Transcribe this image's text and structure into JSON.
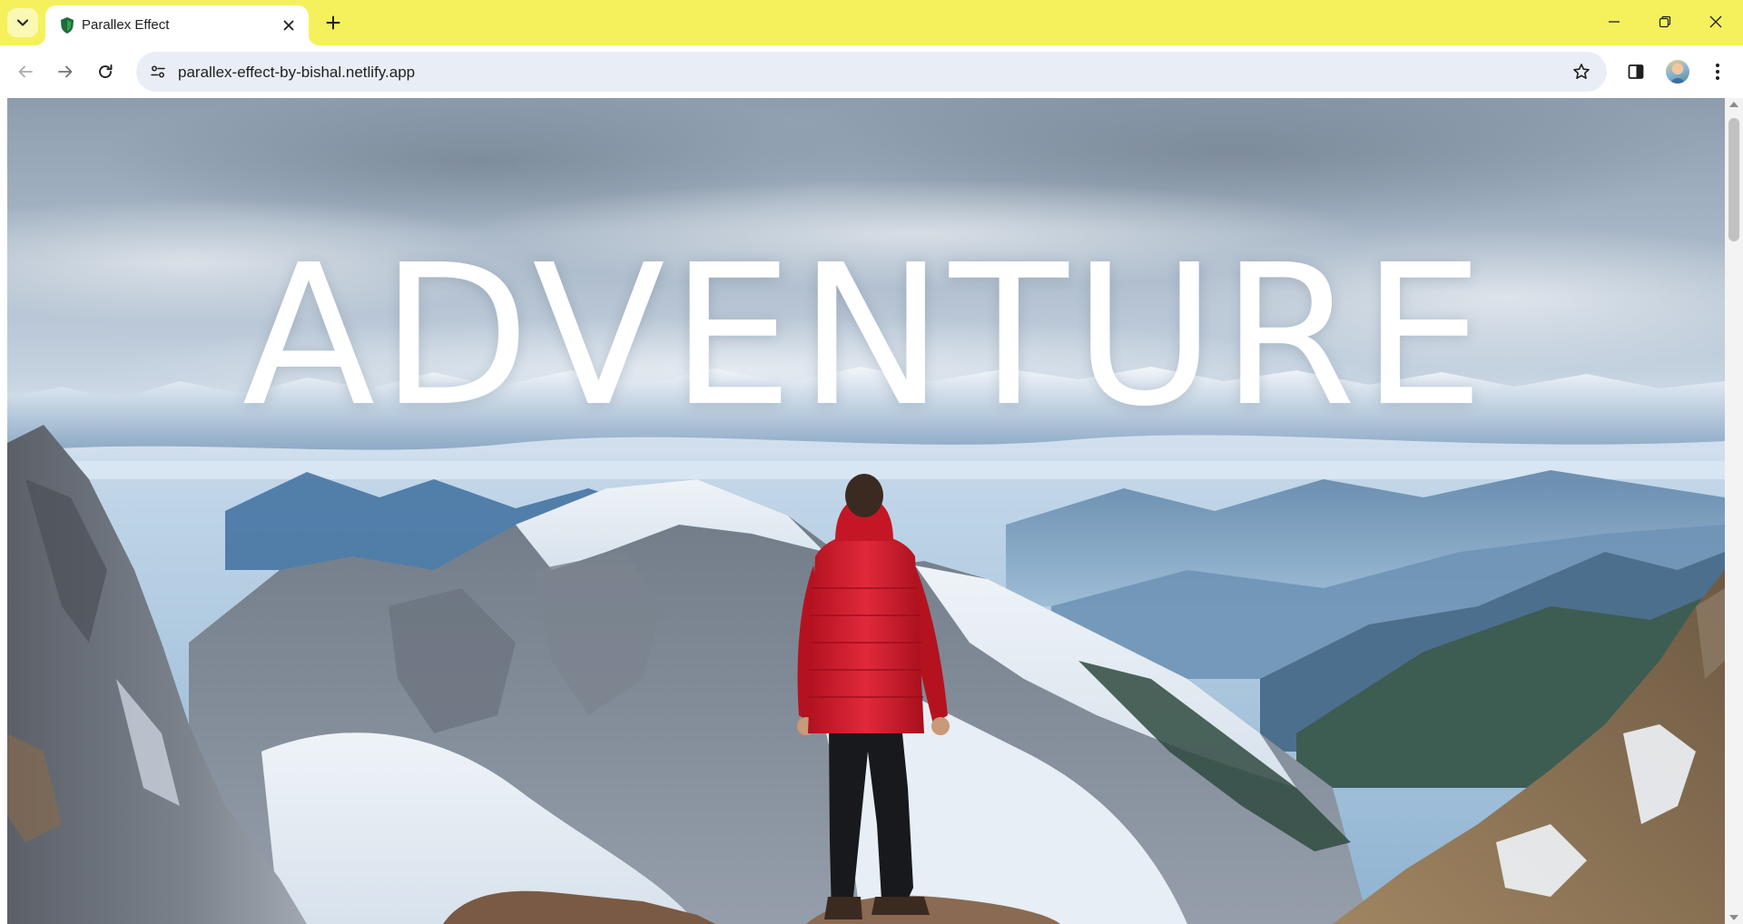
{
  "browser": {
    "tab": {
      "title": "Parallex Effect",
      "favicon": "shield-favicon-icon"
    },
    "tabstrip_color": "#f5f15c",
    "address_bar": {
      "url": "parallex-effect-by-bishal.netlify.app"
    },
    "icons": {
      "tab_search": "chevron-down-icon",
      "tab_close": "close-icon",
      "new_tab": "plus-icon",
      "minimize": "minimize-icon",
      "restore": "restore-icon",
      "window_close": "close-icon",
      "back": "arrow-left-icon",
      "forward": "arrow-right-icon",
      "reload": "reload-icon",
      "site_info": "site-settings-icon",
      "bookmark": "star-icon",
      "side_panel": "side-panel-icon",
      "profile": "avatar",
      "menu": "kebab-menu-icon"
    }
  },
  "page": {
    "hero_title": "ADVENTURE",
    "scene": "mountain-landscape-with-hiker-in-red-jacket",
    "accent_jacket_color": "#d9202e"
  }
}
